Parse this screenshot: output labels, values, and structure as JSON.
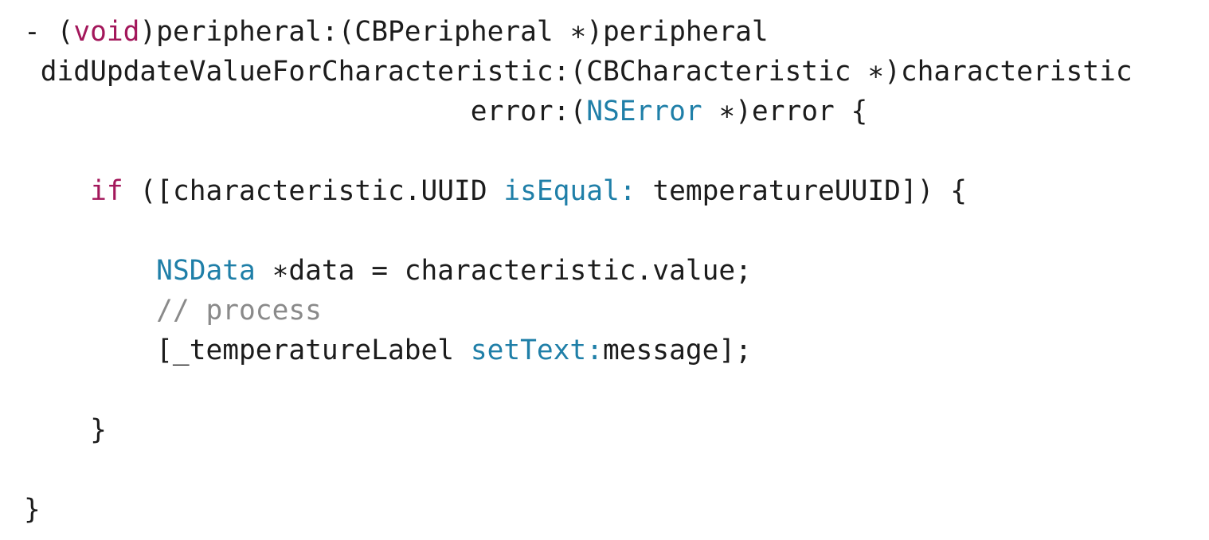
{
  "code": {
    "lines": [
      {
        "segments": [
          {
            "text": "- (",
            "kind": "plain"
          },
          {
            "text": "void",
            "kind": "keyword"
          },
          {
            "text": ")peripheral:(CBPeripheral ∗)peripheral",
            "kind": "plain"
          }
        ]
      },
      {
        "segments": [
          {
            "text": " didUpdateValueForCharacteristic:(CBCharacteristic ∗)characteristic",
            "kind": "plain"
          }
        ]
      },
      {
        "segments": [
          {
            "text": "                           error:(",
            "kind": "plain"
          },
          {
            "text": "NSError",
            "kind": "type"
          },
          {
            "text": " ∗)error {",
            "kind": "plain"
          }
        ]
      },
      {
        "segments": []
      },
      {
        "segments": [
          {
            "text": "    ",
            "kind": "plain"
          },
          {
            "text": "if",
            "kind": "keyword"
          },
          {
            "text": " ([characteristic.UUID ",
            "kind": "plain"
          },
          {
            "text": "isEqual:",
            "kind": "method"
          },
          {
            "text": " temperatureUUID]) {",
            "kind": "plain"
          }
        ]
      },
      {
        "segments": []
      },
      {
        "segments": [
          {
            "text": "        ",
            "kind": "plain"
          },
          {
            "text": "NSData",
            "kind": "type"
          },
          {
            "text": " ∗data = characteristic.value;",
            "kind": "plain"
          }
        ]
      },
      {
        "segments": [
          {
            "text": "        ",
            "kind": "plain"
          },
          {
            "text": "// process",
            "kind": "comment"
          }
        ]
      },
      {
        "segments": [
          {
            "text": "        [_temperatureLabel ",
            "kind": "plain"
          },
          {
            "text": "setText:",
            "kind": "method"
          },
          {
            "text": "message];",
            "kind": "plain"
          }
        ]
      },
      {
        "segments": []
      },
      {
        "segments": [
          {
            "text": "    }",
            "kind": "plain"
          }
        ]
      },
      {
        "segments": []
      },
      {
        "segments": [
          {
            "text": "}",
            "kind": "plain"
          }
        ]
      }
    ]
  },
  "colors": {
    "keyword": "#a3175b",
    "type": "#1f7fa8",
    "method": "#1f7fa8",
    "comment": "#8a8a8a",
    "plain": "#1c1c1c",
    "background": "#ffffff"
  }
}
